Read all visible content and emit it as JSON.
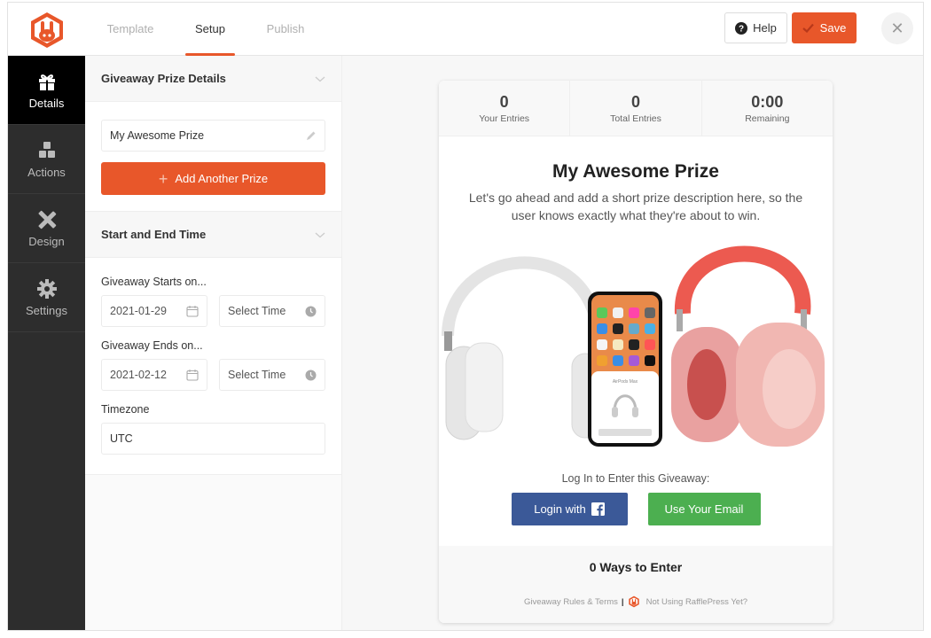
{
  "topbar": {
    "tabs": [
      {
        "label": "Template",
        "active": false
      },
      {
        "label": "Setup",
        "active": true
      },
      {
        "label": "Publish",
        "active": false
      }
    ],
    "help_label": "Help",
    "save_label": "Save",
    "close_icon": "close-icon"
  },
  "sidebar": {
    "items": [
      {
        "label": "Details",
        "icon": "gift-icon",
        "active": true
      },
      {
        "label": "Actions",
        "icon": "cubes-icon",
        "active": false
      },
      {
        "label": "Design",
        "icon": "pencil-ruler-icon",
        "active": false
      },
      {
        "label": "Settings",
        "icon": "gear-icon",
        "active": false
      }
    ]
  },
  "panel": {
    "prize_section": {
      "title": "Giveaway Prize Details",
      "prize_name": "My Awesome Prize",
      "add_button": "Add Another Prize"
    },
    "time_section": {
      "title": "Start and End Time",
      "start_label": "Giveaway Starts on...",
      "start_date": "2021-01-29",
      "start_time_placeholder": "Select Time",
      "end_label": "Giveaway Ends on...",
      "end_date": "2021-02-12",
      "end_time_placeholder": "Select Time",
      "timezone_label": "Timezone",
      "timezone_value": "UTC"
    }
  },
  "preview": {
    "stats": [
      {
        "value": "0",
        "caption": "Your Entries"
      },
      {
        "value": "0",
        "caption": "Total Entries"
      },
      {
        "value": "0:00",
        "caption": "Remaining"
      }
    ],
    "title": "My Awesome Prize",
    "description": "Let's go ahead and add a short prize description here, so the user knows exactly what they're about to win.",
    "image_alt": "AirPods Max headphones with iPhone",
    "phone_popup_title": "AirPods Max",
    "login_label": "Log In to Enter this Giveaway:",
    "facebook_button": "Login with",
    "email_button": "Use Your Email",
    "ways_to_enter": "0 Ways to Enter",
    "rules_link": "Giveaway Rules & Terms",
    "separator": "|",
    "promo_link": "Not Using RafflePress Yet?"
  },
  "colors": {
    "accent": "#e8572a",
    "facebook": "#3b5998",
    "email": "#4caf50",
    "sidebar": "#2d2d2d"
  }
}
